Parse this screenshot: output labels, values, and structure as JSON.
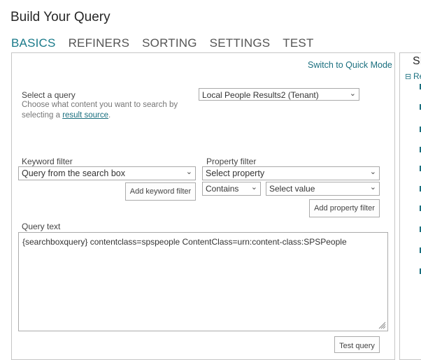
{
  "header": {
    "title": "Build Your Query"
  },
  "tabs": [
    {
      "label": "BASICS",
      "active": true
    },
    {
      "label": "REFINERS",
      "active": false
    },
    {
      "label": "SORTING",
      "active": false
    },
    {
      "label": "SETTINGS",
      "active": false
    },
    {
      "label": "TEST",
      "active": false
    }
  ],
  "basics": {
    "switch_link": "Switch to Quick Mode",
    "select_query_label": "Select a query",
    "select_query_help": "Choose what content you want to search by selecting a",
    "result_source_link": "result source",
    "select_query_value": "Local People Results2 (Tenant)",
    "keyword_filter_label": "Keyword filter",
    "keyword_filter_value": "Query from the search box",
    "add_keyword_button": "Add keyword filter",
    "property_filter_label": "Property filter",
    "property_select_value": "Select property",
    "operator_value": "Contains",
    "value_select_value": "Select value",
    "add_property_button": "Add property filter",
    "query_text_label": "Query text",
    "query_text_value": "{searchboxquery} contentclass=spspeople ContentClass=urn:content-class:SPSPeople",
    "test_query_button": "Test query"
  },
  "side_panel": {
    "title": "SP",
    "link": "Re"
  },
  "colors": {
    "accent": "#1a7a8a",
    "link": "#1a6f7f",
    "border": "#c6c6c6"
  }
}
